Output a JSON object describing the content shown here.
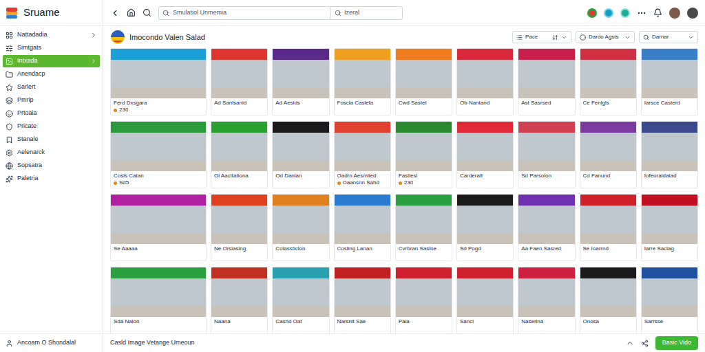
{
  "app": {
    "name": "Sruame"
  },
  "search": {
    "value": "Smulatiol Unmemia",
    "scope": "Izeral"
  },
  "sidebar": {
    "items": [
      {
        "label": "Nattadadia",
        "selected": false,
        "expandable": true
      },
      {
        "label": "Simtgats",
        "selected": false,
        "expandable": false
      },
      {
        "label": "Intxada",
        "selected": true,
        "expandable": true
      },
      {
        "label": "Anendacp",
        "selected": false,
        "expandable": false
      },
      {
        "label": "Sarlert",
        "selected": false,
        "expandable": false
      },
      {
        "label": "Pmrip",
        "selected": false,
        "expandable": false
      },
      {
        "label": "Prtoaia",
        "selected": false,
        "expandable": false
      },
      {
        "label": "Pricate",
        "selected": false,
        "expandable": false
      },
      {
        "label": "Stanale",
        "selected": false,
        "expandable": false
      },
      {
        "label": "Aelenarck",
        "selected": false,
        "expandable": false
      },
      {
        "label": "Sopsatra",
        "selected": false,
        "expandable": false
      },
      {
        "label": "Paletria",
        "selected": false,
        "expandable": false
      }
    ],
    "footer": "Ancoam O Shondalal"
  },
  "page": {
    "title": "Imocondo Valen Salad"
  },
  "filters": [
    {
      "label": "Pace"
    },
    {
      "label": "Dardo Agsts"
    },
    {
      "label": "Darnar"
    }
  ],
  "gallery": {
    "items": [
      {
        "caption": "Ferd Dxsgara",
        "meta": "230",
        "color": "#1a9fd6"
      },
      {
        "caption": "Ad Sanlsanid",
        "meta": "",
        "color": "#e0342f"
      },
      {
        "caption": "Ad Aeslds",
        "meta": "",
        "color": "#5a2a8a"
      },
      {
        "caption": "Foscla Caslela",
        "meta": "",
        "color": "#f0a020"
      },
      {
        "caption": "Cwd Sastet",
        "meta": "",
        "color": "#f07c1e"
      },
      {
        "caption": "Ob Nantand",
        "meta": "",
        "color": "#d8283a"
      },
      {
        "caption": "Ast Sasrsed",
        "meta": "",
        "color": "#c8204a"
      },
      {
        "caption": "Ce Fenlgls",
        "meta": "",
        "color": "#d03040"
      },
      {
        "caption": "Iarsce Casterd",
        "meta": "",
        "color": "#3a7ec8"
      },
      {
        "caption": "Cosls Catan",
        "meta": "Sd5",
        "color": "#2a9a3a"
      },
      {
        "caption": "Oi Aacttationa",
        "meta": "",
        "color": "#2aa030"
      },
      {
        "caption": "Od Danlan",
        "meta": "",
        "color": "#1a1a1a"
      },
      {
        "caption": "Oadrn Aesmlied",
        "meta": "Oaansnn Sahd",
        "color": "#e04030"
      },
      {
        "caption": "Fastlesl",
        "meta": "230",
        "color": "#2a8a30"
      },
      {
        "caption": "Carderalt",
        "meta": "",
        "color": "#e02a3a"
      },
      {
        "caption": "Sd Parsolon",
        "meta": "",
        "color": "#d04050"
      },
      {
        "caption": "Cd Fanund",
        "meta": "",
        "color": "#7a3aa0"
      },
      {
        "caption": "Iofeoraldatad",
        "meta": "",
        "color": "#3a4a8a"
      },
      {
        "caption": "Se Aaaaa",
        "meta": "",
        "color": "#b020a0"
      },
      {
        "caption": "Ne Orsiasing",
        "meta": "",
        "color": "#e04020"
      },
      {
        "caption": "Colassticlon",
        "meta": "",
        "color": "#e08020"
      },
      {
        "caption": "Cosling Lanan",
        "meta": "",
        "color": "#2a7ad0"
      },
      {
        "caption": "Cvrbran Saslne",
        "meta": "",
        "color": "#2aa040"
      },
      {
        "caption": "Sd Pogd",
        "meta": "",
        "color": "#1a1a1a"
      },
      {
        "caption": "Aa Faen Sasred",
        "meta": "",
        "color": "#7030b0"
      },
      {
        "caption": "Se Ioarrnd",
        "meta": "",
        "color": "#d0202a"
      },
      {
        "caption": "Iarre Saclag",
        "meta": "",
        "color": "#c01020"
      },
      {
        "caption": "Sda Nalon",
        "meta": "",
        "color": "#2aa040"
      },
      {
        "caption": "Naana",
        "meta": "",
        "color": "#c03020"
      },
      {
        "caption": "Casnd Oat",
        "meta": "",
        "color": "#2aa0b0"
      },
      {
        "caption": "Narsnit Sae",
        "meta": "",
        "color": "#c02020"
      },
      {
        "caption": "Pala",
        "meta": "",
        "color": "#d02030"
      },
      {
        "caption": "Sancl",
        "meta": "",
        "color": "#d02030"
      },
      {
        "caption": "Naserina",
        "meta": "",
        "color": "#d02040"
      },
      {
        "caption": "Onosa",
        "meta": "",
        "color": "#1a1a1a"
      },
      {
        "caption": "Sarrsse",
        "meta": "",
        "color": "#2050a0"
      }
    ]
  },
  "status_bar": {
    "text": "Casld Image Vetange Umeoun",
    "button": "Basic Vido"
  }
}
